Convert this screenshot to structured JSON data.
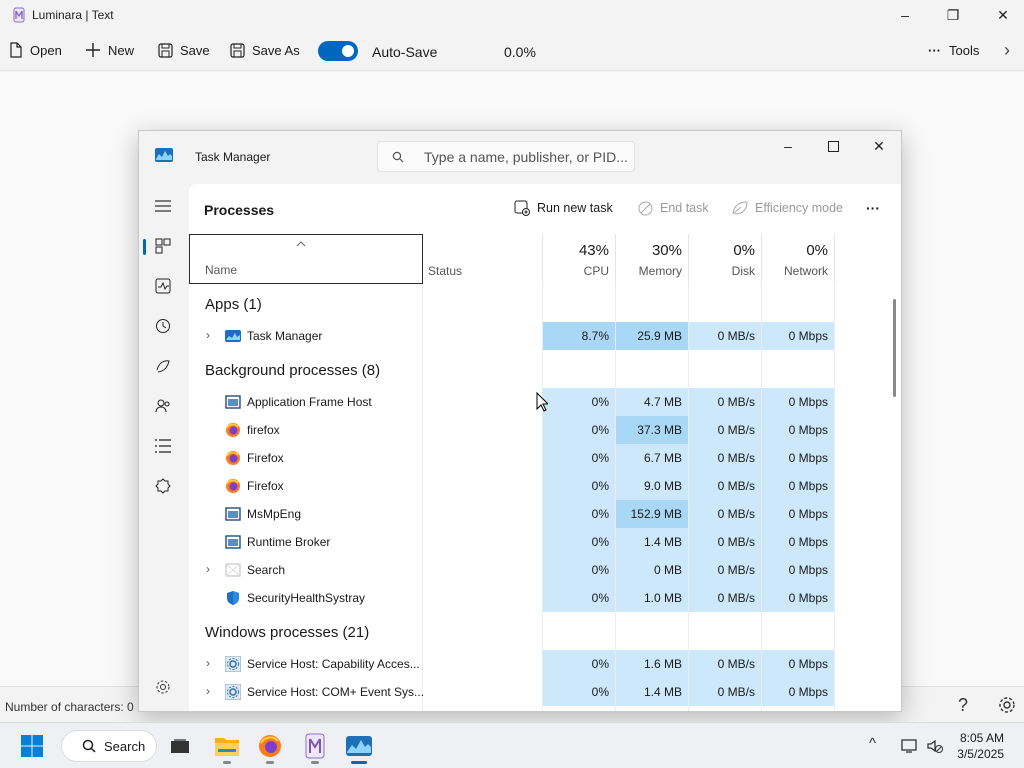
{
  "window": {
    "title": "Luminara | Text",
    "minimize": "–",
    "restore": "❐",
    "close": "✕"
  },
  "toolbar": {
    "open_label": "Open",
    "new_label": "New",
    "save_label": "Save",
    "save_as_label": "Save As",
    "autosave_label": "Auto-Save",
    "autosave_on": true,
    "progress": "0.0%",
    "tools_label": "Tools",
    "more": "···",
    "chevron": "›"
  },
  "statusbar": {
    "char_count": "Number of characters: 0",
    "help": "?"
  },
  "taskmanager": {
    "title": "Task Manager",
    "search_placeholder": "Type a name, publisher, or PID...",
    "page_title": "Processes",
    "run_new_task": "Run new task",
    "end_task": "End task",
    "efficiency_mode": "Efficiency mode",
    "more": "···",
    "columns": {
      "name": "Name",
      "status": "Status",
      "cpu_pct": "43%",
      "cpu": "CPU",
      "mem_pct": "30%",
      "mem": "Memory",
      "disk_pct": "0%",
      "disk": "Disk",
      "net_pct": "0%",
      "net": "Network"
    },
    "groups": {
      "apps": "Apps (1)",
      "background": "Background processes (8)",
      "windows": "Windows processes (21)"
    },
    "apps": [
      {
        "name": "Task Manager",
        "cpu": "8.7%",
        "mem": "25.9 MB",
        "disk": "0 MB/s",
        "net": "0 Mbps"
      }
    ],
    "background": [
      {
        "name": "Application Frame Host",
        "cpu": "0%",
        "mem": "4.7 MB",
        "disk": "0 MB/s",
        "net": "0 Mbps"
      },
      {
        "name": "firefox",
        "cpu": "0%",
        "mem": "37.3 MB",
        "disk": "0 MB/s",
        "net": "0 Mbps"
      },
      {
        "name": "Firefox",
        "cpu": "0%",
        "mem": "6.7 MB",
        "disk": "0 MB/s",
        "net": "0 Mbps"
      },
      {
        "name": "Firefox",
        "cpu": "0%",
        "mem": "9.0 MB",
        "disk": "0 MB/s",
        "net": "0 Mbps"
      },
      {
        "name": "MsMpEng",
        "cpu": "0%",
        "mem": "152.9 MB",
        "disk": "0 MB/s",
        "net": "0 Mbps"
      },
      {
        "name": "Runtime Broker",
        "cpu": "0%",
        "mem": "1.4 MB",
        "disk": "0 MB/s",
        "net": "0 Mbps"
      },
      {
        "name": "Search",
        "cpu": "0%",
        "mem": "0 MB",
        "disk": "0 MB/s",
        "net": "0 Mbps"
      },
      {
        "name": "SecurityHealthSystray",
        "cpu": "0%",
        "mem": "1.0 MB",
        "disk": "0 MB/s",
        "net": "0 Mbps"
      }
    ],
    "windows": [
      {
        "name": "Service Host: Capability Acces...",
        "cpu": "0%",
        "mem": "1.6 MB",
        "disk": "0 MB/s",
        "net": "0 Mbps"
      },
      {
        "name": "Service Host: COM+ Event Sys...",
        "cpu": "0%",
        "mem": "1.4 MB",
        "disk": "0 MB/s",
        "net": "0 Mbps"
      }
    ]
  },
  "taskbar": {
    "search_label": "Search",
    "time": "8:05 AM",
    "date": "3/5/2025",
    "tray_chevron": "^"
  },
  "colors": {
    "accent": "#0067c0",
    "heat_light": "#cde8fb",
    "heat_mid": "#a9d8f7"
  }
}
